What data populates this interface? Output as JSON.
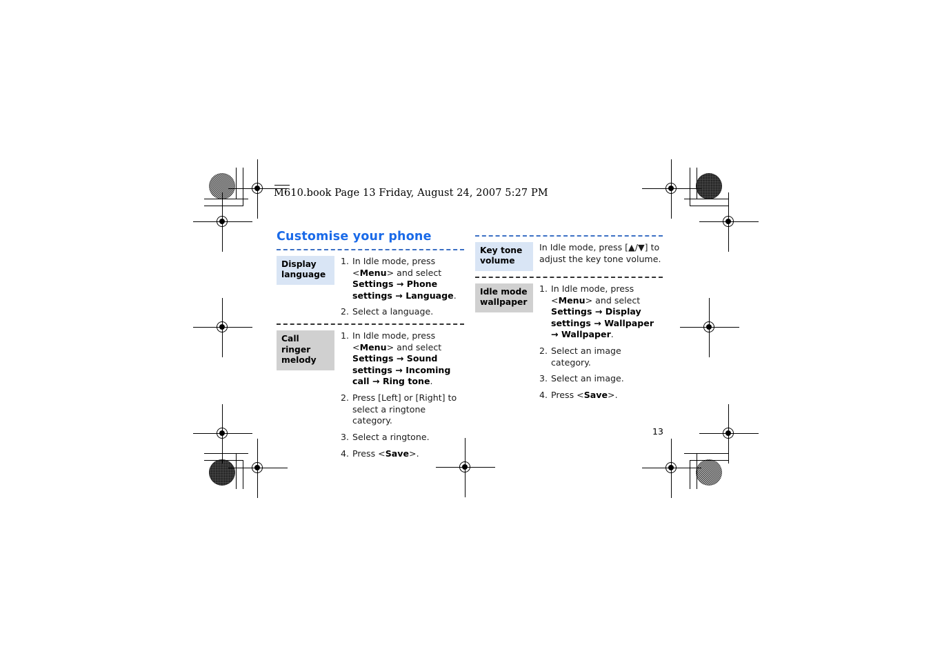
{
  "header": {
    "file_line": "M610.book  Page 13  Friday, August 24, 2007  5:27 PM"
  },
  "chapter": {
    "title": "Customise your phone"
  },
  "page_number": "13",
  "colors": {
    "heading_blue": "#1a6ae8",
    "divider_blue": "#3a6fc4",
    "divider_grey": "#2f2f2f",
    "label_blue_bg": "#d9e5f5",
    "label_grey_bg": "#d0d0d0"
  },
  "columns": {
    "left": [
      {
        "label": "Display language",
        "label_style": "blue",
        "steps": [
          {
            "parts": [
              {
                "t": "In Idle mode, press <",
                "b": false
              },
              {
                "t": "Menu",
                "b": true
              },
              {
                "t": "> and select ",
                "b": false
              },
              {
                "t": "Settings",
                "b": true
              },
              {
                "t": " → ",
                "b": true,
                "arrow": true
              },
              {
                "t": "Phone settings",
                "b": true
              },
              {
                "t": " → ",
                "b": true,
                "arrow": true
              },
              {
                "t": "Language",
                "b": true
              },
              {
                "t": ".",
                "b": false
              }
            ]
          },
          {
            "parts": [
              {
                "t": "Select a language.",
                "b": false
              }
            ]
          }
        ]
      },
      {
        "label": "Call ringer melody",
        "label_style": "grey",
        "steps": [
          {
            "parts": [
              {
                "t": "In Idle mode, press <",
                "b": false
              },
              {
                "t": "Menu",
                "b": true
              },
              {
                "t": "> and select ",
                "b": false
              },
              {
                "t": "Settings",
                "b": true
              },
              {
                "t": " → ",
                "b": true,
                "arrow": true
              },
              {
                "t": "Sound settings",
                "b": true
              },
              {
                "t": " → ",
                "b": true,
                "arrow": true
              },
              {
                "t": "Incoming call",
                "b": true
              },
              {
                "t": " → ",
                "b": true,
                "arrow": true
              },
              {
                "t": "Ring tone",
                "b": true
              },
              {
                "t": ".",
                "b": false
              }
            ]
          },
          {
            "parts": [
              {
                "t": "Press [Left] or [Right] to select a ringtone category.",
                "b": false
              }
            ]
          },
          {
            "parts": [
              {
                "t": "Select a ringtone.",
                "b": false
              }
            ]
          },
          {
            "parts": [
              {
                "t": "Press <",
                "b": false
              },
              {
                "t": "Save",
                "b": true
              },
              {
                "t": ">.",
                "b": false
              }
            ]
          }
        ]
      }
    ],
    "right": [
      {
        "label": "Key tone volume",
        "label_style": "blue",
        "plain": {
          "parts": [
            {
              "t": "In Idle mode, press [▲/▼] to adjust the key tone volume.",
              "b": false
            }
          ]
        }
      },
      {
        "label": "Idle mode wallpaper",
        "label_style": "grey",
        "steps": [
          {
            "parts": [
              {
                "t": "In Idle mode, press <",
                "b": false
              },
              {
                "t": "Menu",
                "b": true
              },
              {
                "t": "> and select ",
                "b": false
              },
              {
                "t": "Settings",
                "b": true
              },
              {
                "t": " → ",
                "b": true,
                "arrow": true
              },
              {
                "t": "Display settings",
                "b": true
              },
              {
                "t": " → ",
                "b": true,
                "arrow": true
              },
              {
                "t": "Wallpaper",
                "b": true
              },
              {
                "t": " → ",
                "b": true,
                "arrow": true
              },
              {
                "t": "Wallpaper",
                "b": true
              },
              {
                "t": ".",
                "b": false
              }
            ]
          },
          {
            "parts": [
              {
                "t": "Select an image category.",
                "b": false
              }
            ]
          },
          {
            "parts": [
              {
                "t": "Select an image.",
                "b": false
              }
            ]
          },
          {
            "parts": [
              {
                "t": "Press <",
                "b": false
              },
              {
                "t": "Save",
                "b": true
              },
              {
                "t": ">.",
                "b": false
              }
            ]
          }
        ]
      }
    ]
  }
}
